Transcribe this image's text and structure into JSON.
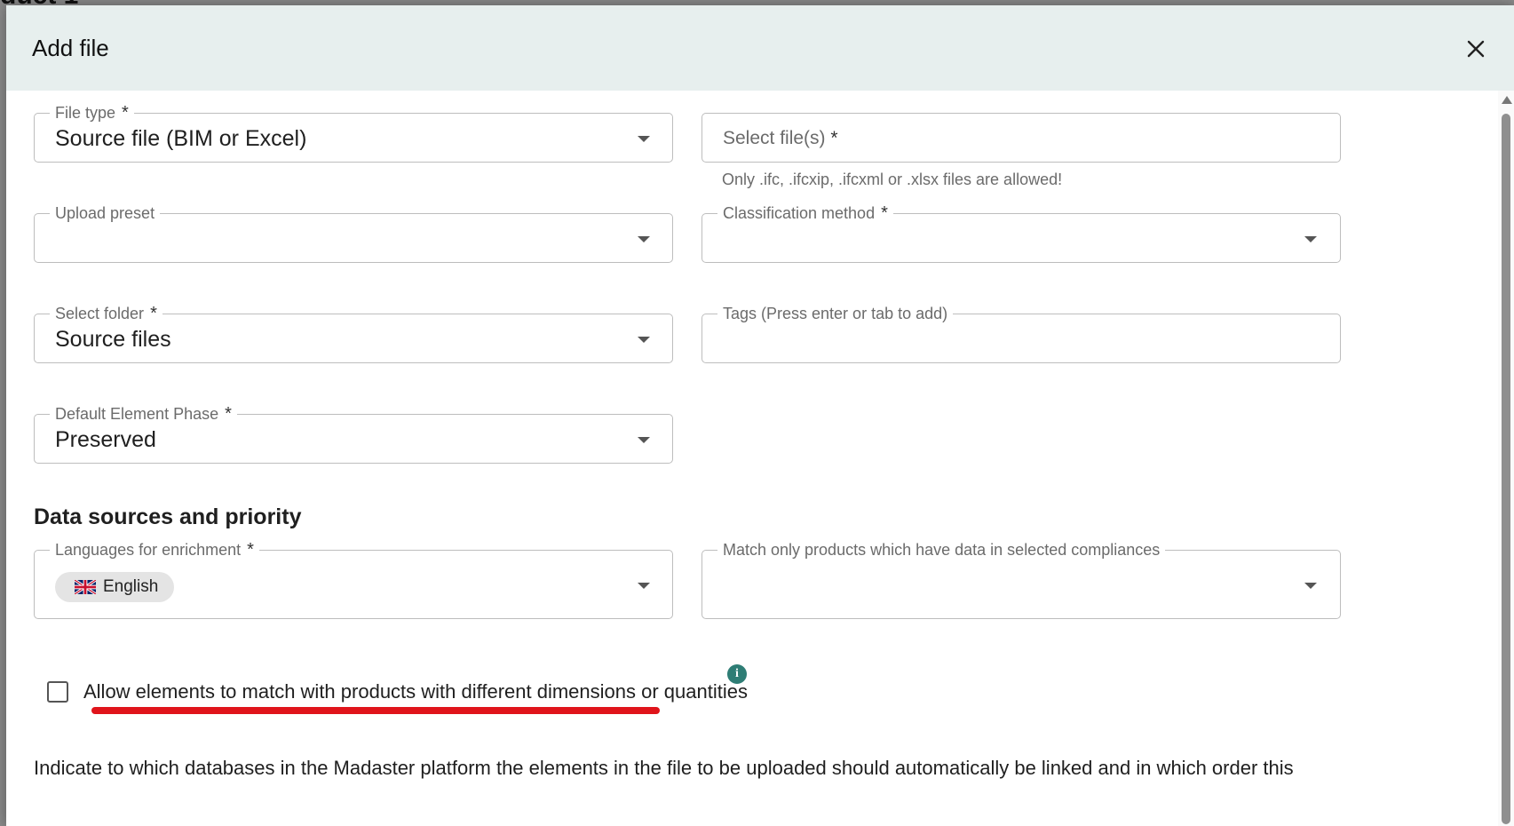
{
  "background": {
    "title_fragment": "duct 1"
  },
  "dialog": {
    "title": "Add file",
    "close_icon": "close-icon"
  },
  "fields": {
    "file_type": {
      "label": "File type",
      "required": "*",
      "value": "Source file (BIM or Excel)"
    },
    "select_files": {
      "placeholder": "Select file(s)",
      "required": "*",
      "helper": "Only .ifc, .ifcxip, .ifcxml or .xlsx files are allowed!"
    },
    "upload_preset": {
      "label": "Upload preset",
      "value": ""
    },
    "classification_method": {
      "label": "Classification method",
      "required": "*",
      "value": ""
    },
    "select_folder": {
      "label": "Select folder",
      "required": "*",
      "value": "Source files"
    },
    "tags": {
      "label": "Tags (Press enter or tab to add)",
      "value": ""
    },
    "default_phase": {
      "label": "Default Element Phase",
      "required": "*",
      "value": "Preserved"
    }
  },
  "data_sources": {
    "title": "Data sources and priority",
    "languages": {
      "label": "Languages for enrichment",
      "required": "*",
      "chips": [
        {
          "label": "English",
          "icon": "uk-flag-icon"
        }
      ]
    },
    "compliances": {
      "label": "Match only products which have data in selected compliances",
      "value": ""
    }
  },
  "allow_match": {
    "label": "Allow elements to match with products with different dimensions or quantities",
    "checked": false,
    "info_icon": "i"
  },
  "bottom_text": "Indicate to which databases in the Madaster platform the elements in the file to be uploaded should automatically be linked and in which order this",
  "colors": {
    "header_bg": "#e7efee",
    "accent": "#2e7d75",
    "annotation": "#e0141b"
  }
}
